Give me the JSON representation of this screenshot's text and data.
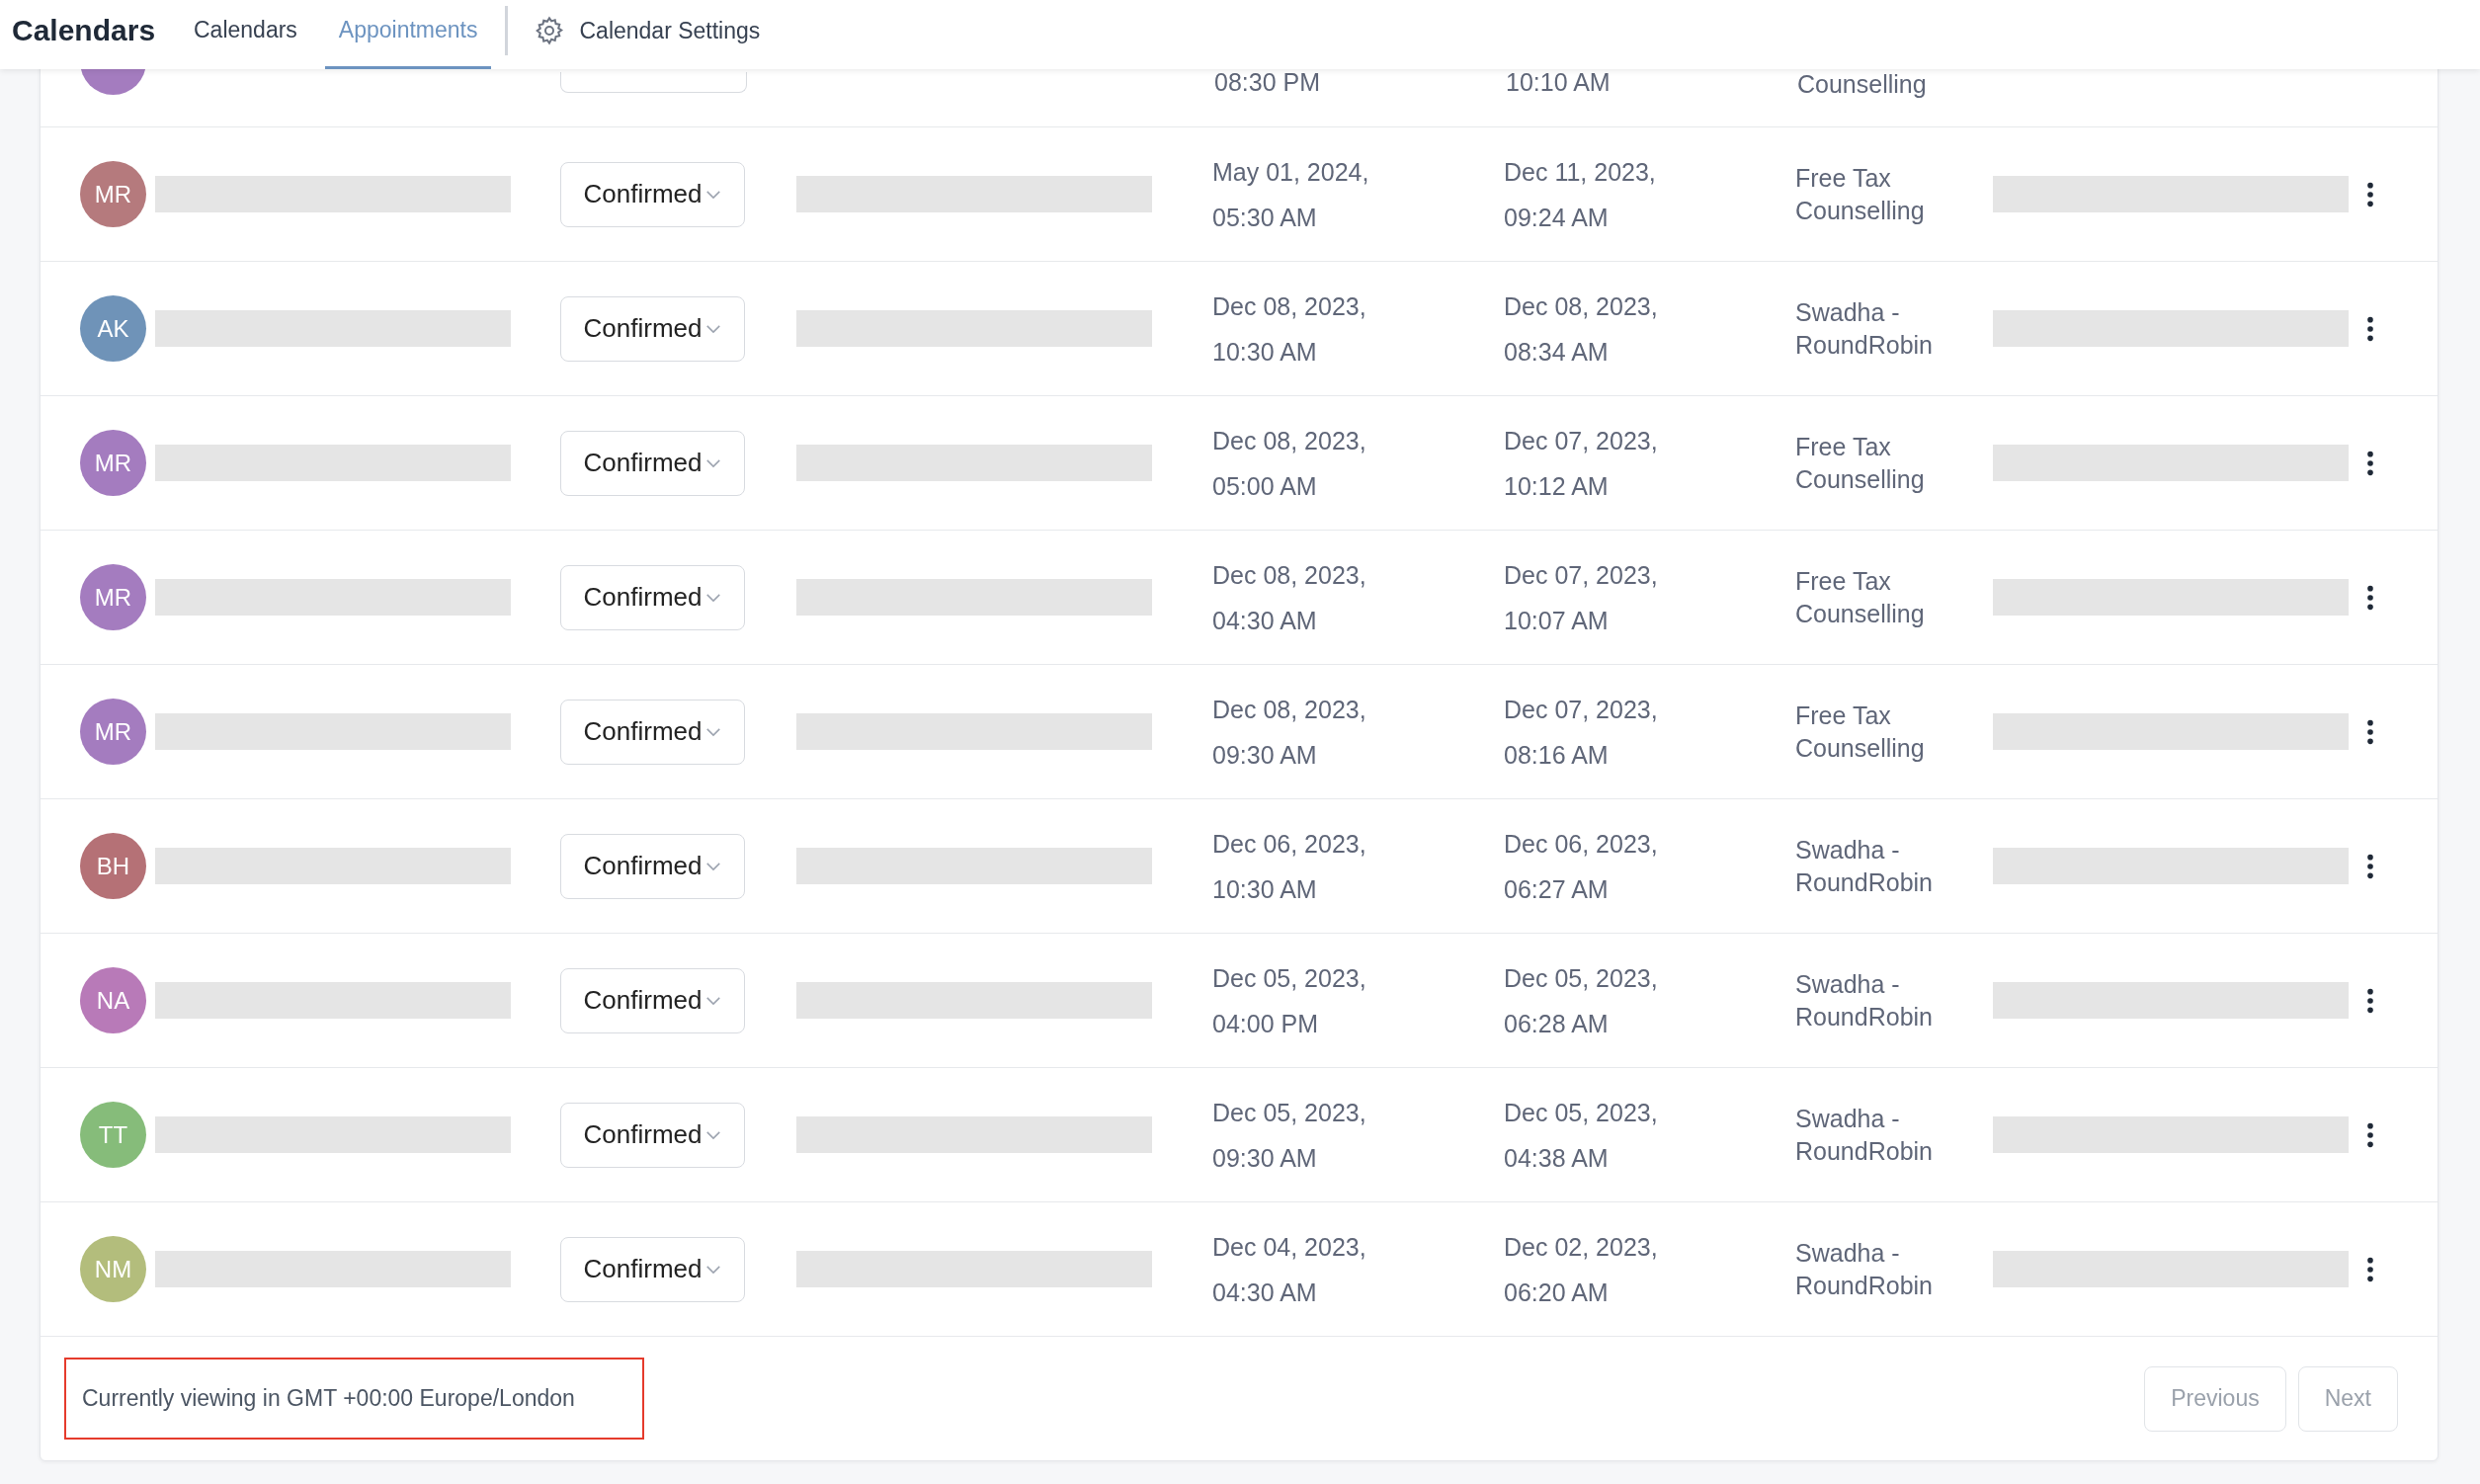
{
  "header": {
    "title": "Calendars",
    "tabs": [
      {
        "label": "Calendars",
        "selected": false
      },
      {
        "label": "Appointments",
        "selected": true
      }
    ],
    "settings_link": "Calendar Settings"
  },
  "partial_row": {
    "color": "#a47cbf",
    "start_time": "08:30 PM",
    "created_time": "10:10 AM",
    "calendar": "Counselling"
  },
  "rows": [
    {
      "initials": "MR",
      "color": "#b57a7d",
      "status": "Confirmed",
      "start_date": "May 01, 2024,",
      "start_time": "05:30 AM",
      "created_date": "Dec 11, 2023,",
      "created_time": "09:24 AM",
      "calendar": "Free Tax Counselling"
    },
    {
      "initials": "AK",
      "color": "#6f93b8",
      "status": "Confirmed",
      "start_date": "Dec 08, 2023,",
      "start_time": "10:30 AM",
      "created_date": "Dec 08, 2023,",
      "created_time": "08:34 AM",
      "calendar": "Swadha - RoundRobin"
    },
    {
      "initials": "MR",
      "color": "#a47cbf",
      "status": "Confirmed",
      "start_date": "Dec 08, 2023,",
      "start_time": "05:00 AM",
      "created_date": "Dec 07, 2023,",
      "created_time": "10:12 AM",
      "calendar": "Free Tax Counselling"
    },
    {
      "initials": "MR",
      "color": "#a47cbf",
      "status": "Confirmed",
      "start_date": "Dec 08, 2023,",
      "start_time": "04:30 AM",
      "created_date": "Dec 07, 2023,",
      "created_time": "10:07 AM",
      "calendar": "Free Tax Counselling"
    },
    {
      "initials": "MR",
      "color": "#a47cbf",
      "status": "Confirmed",
      "start_date": "Dec 08, 2023,",
      "start_time": "09:30 AM",
      "created_date": "Dec 07, 2023,",
      "created_time": "08:16 AM",
      "calendar": "Free Tax Counselling"
    },
    {
      "initials": "BH",
      "color": "#b57176",
      "status": "Confirmed",
      "start_date": "Dec 06, 2023,",
      "start_time": "10:30 AM",
      "created_date": "Dec 06, 2023,",
      "created_time": "06:27 AM",
      "calendar": "Swadha - RoundRobin"
    },
    {
      "initials": "NA",
      "color": "#b87ab8",
      "status": "Confirmed",
      "start_date": "Dec 05, 2023,",
      "start_time": "04:00 PM",
      "created_date": "Dec 05, 2023,",
      "created_time": "06:28 AM",
      "calendar": "Swadha - RoundRobin"
    },
    {
      "initials": "TT",
      "color": "#86bc7a",
      "status": "Confirmed",
      "start_date": "Dec 05, 2023,",
      "start_time": "09:30 AM",
      "created_date": "Dec 05, 2023,",
      "created_time": "04:38 AM",
      "calendar": "Swadha - RoundRobin"
    },
    {
      "initials": "NM",
      "color": "#b3bd7c",
      "status": "Confirmed",
      "start_date": "Dec 04, 2023,",
      "start_time": "04:30 AM",
      "created_date": "Dec 02, 2023,",
      "created_time": "06:20 AM",
      "calendar": "Swadha - RoundRobin"
    }
  ],
  "footer": {
    "timezone": "Currently viewing in GMT +00:00 Europe/London",
    "buttons": [
      {
        "label": "Previous",
        "disabled": true
      },
      {
        "label": "Next",
        "disabled": true
      }
    ]
  }
}
